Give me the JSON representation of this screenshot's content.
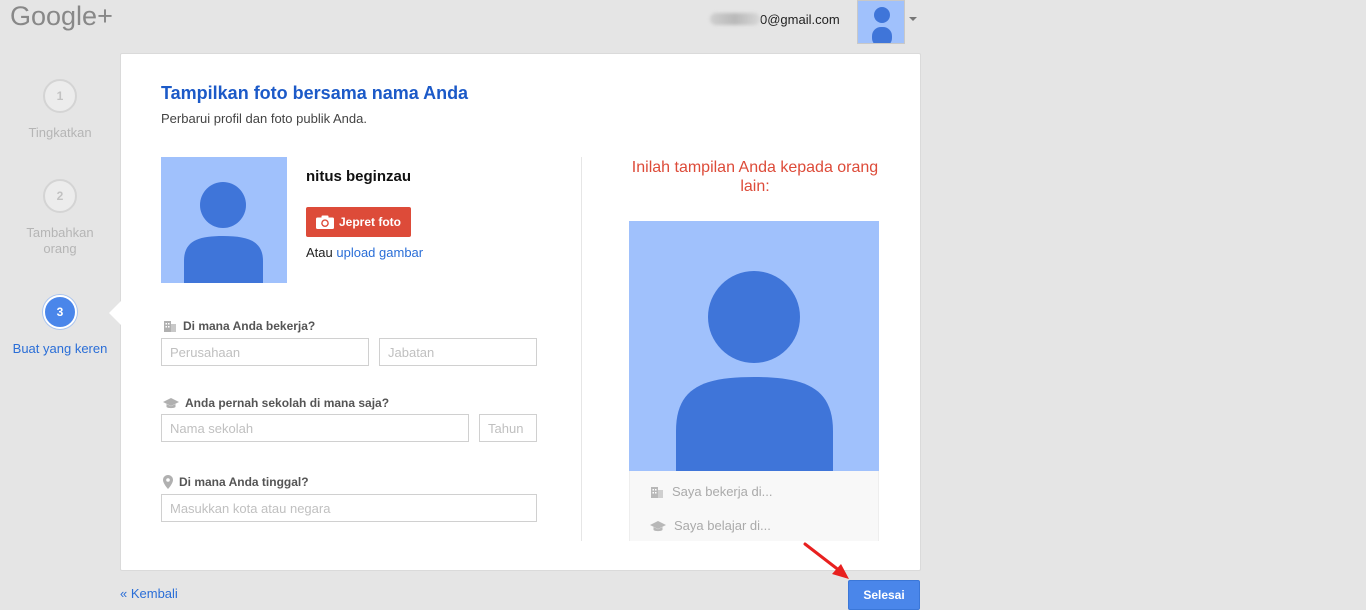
{
  "header": {
    "logo": "Google+",
    "email_suffix": "0@gmail.com"
  },
  "steps": [
    {
      "number": "1",
      "label": "Tingkatkan"
    },
    {
      "number": "2",
      "label": "Tambahkan orang"
    },
    {
      "number": "3",
      "label": "Buat yang keren"
    }
  ],
  "card": {
    "title": "Tampilkan foto bersama nama Anda",
    "subtitle": "Perbarui profil dan foto publik Anda.",
    "name": "nitus beginzau",
    "photo_button": "Jepret foto",
    "upload_prefix": "Atau",
    "upload_link": "upload gambar",
    "work": {
      "question": "Di mana Anda bekerja?",
      "company_placeholder": "Perusahaan",
      "position_placeholder": "Jabatan"
    },
    "school": {
      "question": "Anda pernah sekolah di mana saja?",
      "school_placeholder": "Nama sekolah",
      "year_placeholder": "Tahun"
    },
    "live": {
      "question": "Di mana Anda tinggal?",
      "city_placeholder": "Masukkan kota atau negara"
    },
    "preview": {
      "title": "Inilah tampilan Anda kepada orang lain:",
      "work_text": "Saya bekerja di...",
      "study_text": "Saya belajar di..."
    }
  },
  "footer": {
    "back": "« Kembali",
    "done": "Selesai"
  },
  "colors": {
    "accent_blue": "#4a86ea",
    "title_blue": "#1c5ac8",
    "red": "#dd4b39",
    "avatar_bg": "#a0c1fc",
    "avatar_fg": "#3f75d9"
  }
}
